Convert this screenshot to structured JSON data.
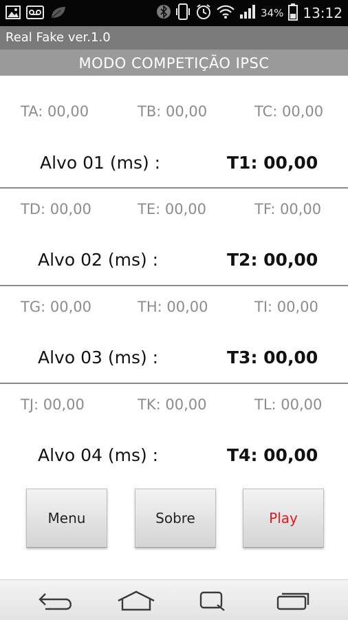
{
  "status_bar": {
    "battery_pct": "34%",
    "time": "13:12",
    "icons": [
      "image-icon",
      "voicemail-icon",
      "leaf-icon",
      "bluetooth-icon",
      "vibrate-icon",
      "alarm-icon",
      "wifi-icon",
      "signal-icon",
      "battery-icon"
    ]
  },
  "app": {
    "title": "Real Fake  ver.1.0",
    "header": "MODO COMPETIÇÃO IPSC"
  },
  "targets": [
    {
      "times": [
        "TA: 00,00",
        "TB: 00,00",
        "TC: 00,00"
      ],
      "label": "Alvo 01 (ms) :",
      "total": "T1: 00,00"
    },
    {
      "times": [
        "TD: 00,00",
        "TE: 00,00",
        "TF: 00,00"
      ],
      "label": "Alvo 02 (ms) :",
      "total": "T2: 00,00"
    },
    {
      "times": [
        "TG: 00,00",
        "TH: 00,00",
        "TI: 00,00"
      ],
      "label": "Alvo 03 (ms) :",
      "total": "T3: 00,00"
    },
    {
      "times": [
        "TJ: 00,00",
        "TK: 00,00",
        "TL: 00,00"
      ],
      "label": "Alvo 04 (ms) :",
      "total": "T4: 00,00"
    }
  ],
  "buttons": {
    "menu": "Menu",
    "sobre": "Sobre",
    "play": "Play"
  },
  "colors": {
    "play_text": "#e81818",
    "header_bg": "#9a9a9a",
    "titlebar_bg": "#7a7a7a"
  },
  "nav_bar": {
    "icons": [
      "back-icon",
      "home-icon",
      "recent-apps-icon",
      "menu-icon"
    ]
  }
}
